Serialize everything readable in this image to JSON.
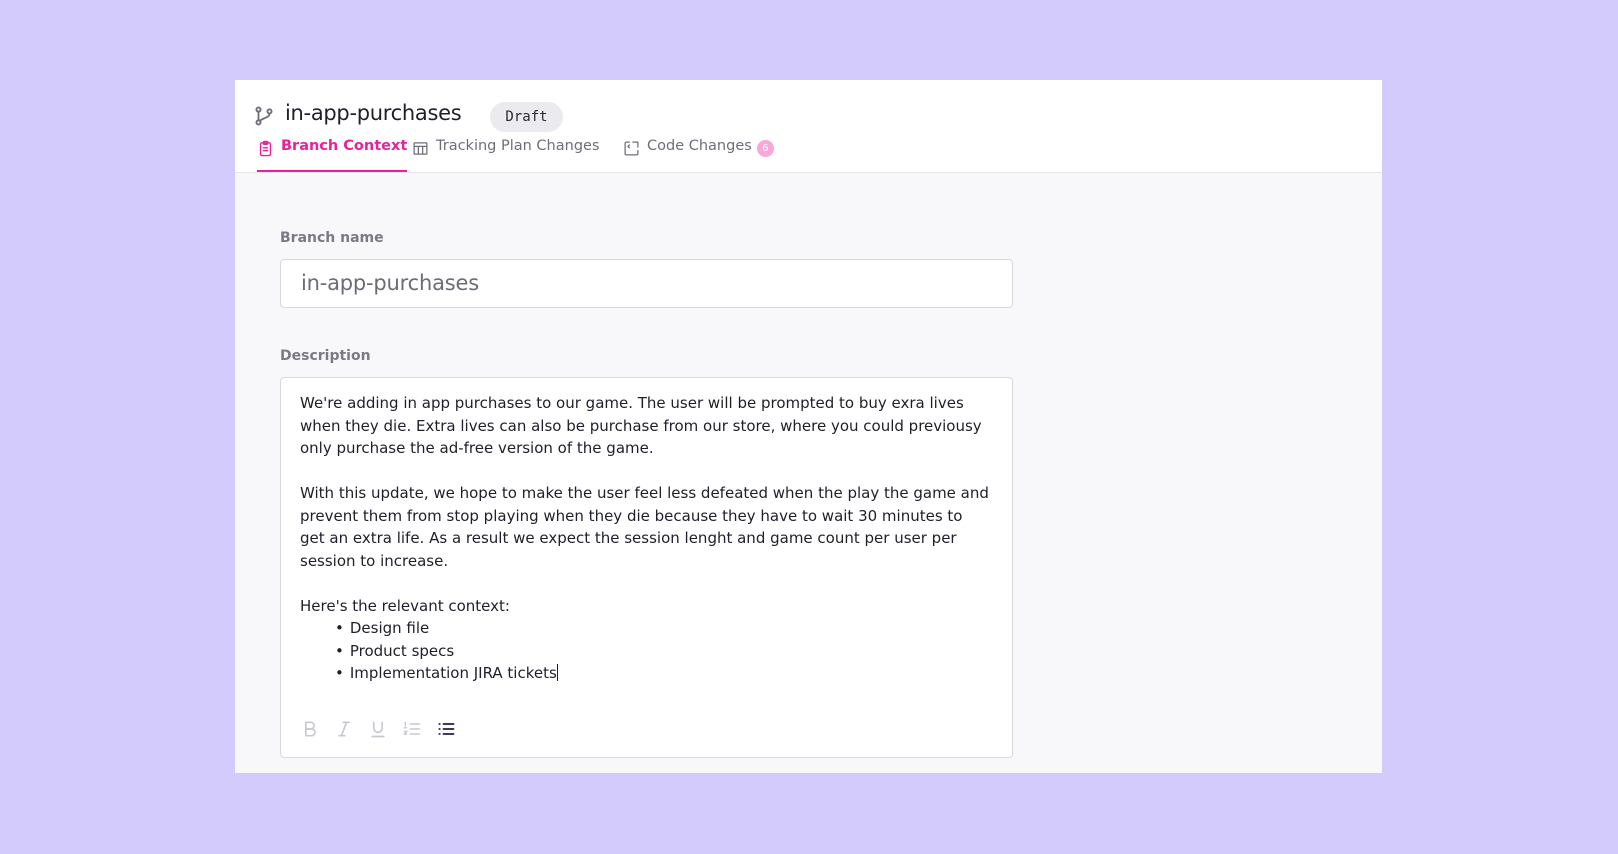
{
  "header": {
    "branch_name": "in-app-purchases",
    "status_badge": "Draft",
    "branch_icon": "git-branch-icon"
  },
  "tabs": [
    {
      "label": "Branch Context",
      "icon": "clipboard-icon",
      "active": true
    },
    {
      "label": "Tracking Plan Changes",
      "icon": "table-icon",
      "active": false
    },
    {
      "label": "Code Changes",
      "icon": "code-bracket-icon",
      "active": false,
      "count": "6"
    }
  ],
  "form": {
    "branch_name_label": "Branch name",
    "branch_name_value": "in-app-purchases",
    "description_label": "Description",
    "description": {
      "paragraph_1": "We're adding in app purchases to our game. The user will be prompted to buy exra lives when they die. Extra lives can also be purchase from our store, where you could previousy only purchase the ad-free version of the game.",
      "paragraph_2": "With this update, we hope to make the user feel less defeated when the play the game and prevent them from stop playing when they die because they have to wait 30 minutes to get an extra life. As a result we expect the session lenght and game count per user per session to increase.",
      "paragraph_3": "Here's the relevant context:",
      "bullets": [
        "Design file",
        "Product specs",
        "Implementation JIRA tickets"
      ]
    },
    "toolbar": [
      {
        "icon": "bold-icon",
        "active": false
      },
      {
        "icon": "italic-icon",
        "active": false
      },
      {
        "icon": "underline-icon",
        "active": false
      },
      {
        "icon": "ordered-list-icon",
        "active": false
      },
      {
        "icon": "bullet-list-icon",
        "active": true
      }
    ]
  },
  "colors": {
    "page_background": "#d4cbfd",
    "accent": "#e6239d",
    "tab_badge": "#f8a8d8",
    "text": "#1f1f2b",
    "muted_text": "#6e6e7a"
  }
}
